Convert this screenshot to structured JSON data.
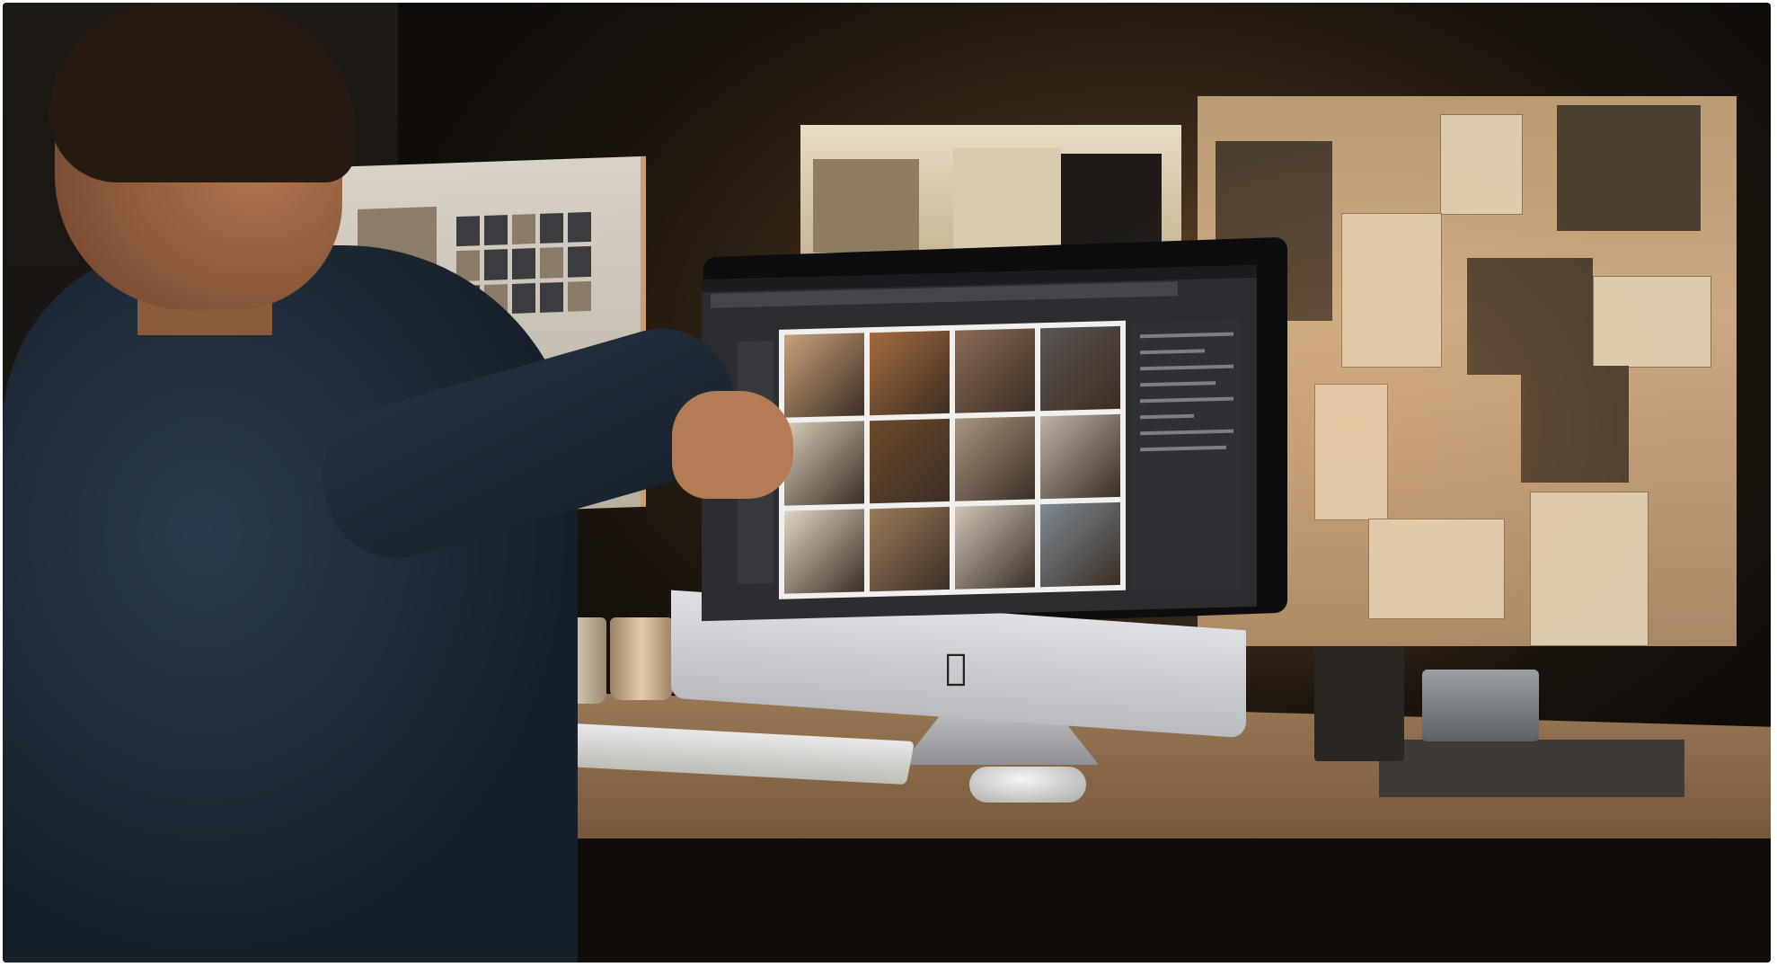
{
  "scene": {
    "screen_app_title": "",
    "icons": {
      "apple_logo": "apple-logo-icon"
    },
    "colors": {
      "wall": "#1c150e",
      "desk": "#9c7a56",
      "screen_ui": "#2b2d31",
      "gallery_bg": "#f1f0ee",
      "warm_light": "#caa983"
    },
    "gallery_thumbnails": [
      "#c9a27a",
      "#a56a3d",
      "#8a6b55",
      "#5b5552",
      "#d7cbb8",
      "#6b4a2c",
      "#a89580",
      "#bdb3a6",
      "#e0d4c2",
      "#9a7b5b",
      "#cfc4b6",
      "#7e8a93"
    ]
  }
}
